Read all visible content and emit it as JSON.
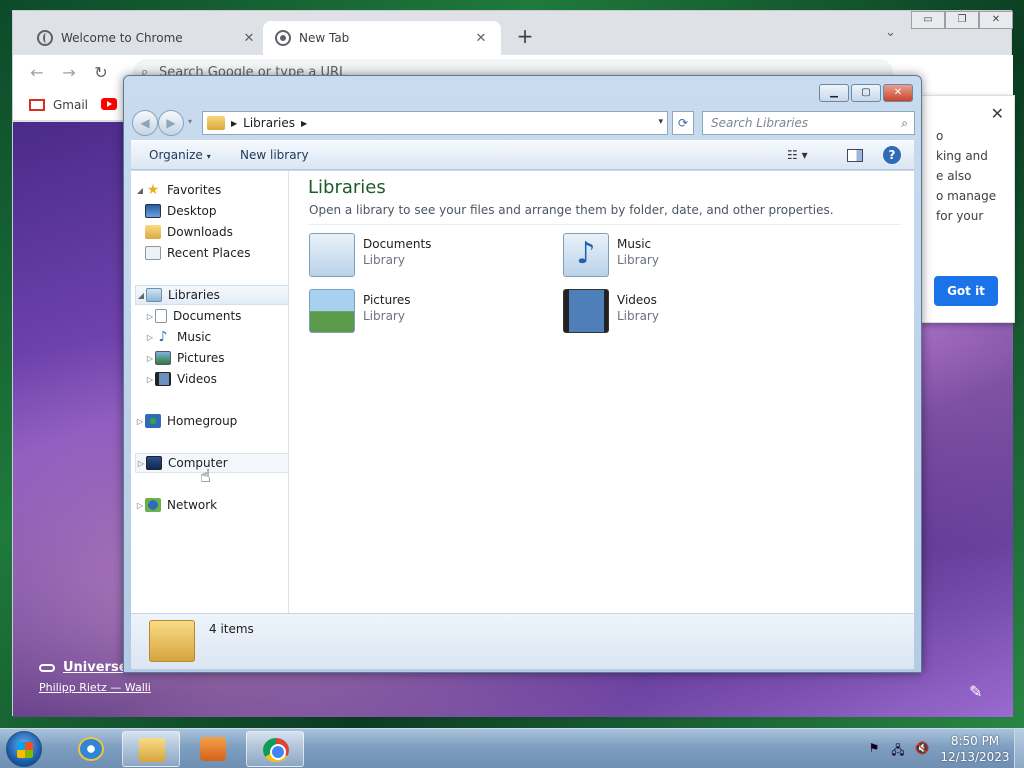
{
  "chrome": {
    "tabs": [
      {
        "label": "Welcome to Chrome",
        "close": "✕"
      },
      {
        "label": "New Tab",
        "close": "✕"
      }
    ],
    "new_tab": "+",
    "tab_search": "⌄",
    "window_controls": {
      "minimize": "▭",
      "restore": "❐",
      "close": "✕"
    },
    "toolbar": {
      "back": "←",
      "forward": "→",
      "reload": "↻",
      "omnibox_placeholder": "Search Google or type a URL"
    },
    "bookmarks": [
      {
        "label": "Gmail"
      }
    ],
    "background_credit": {
      "title": "Universe",
      "author": "Philipp Rietz — Walli"
    },
    "signin_popup": {
      "close": "✕",
      "lines": [
        "o",
        "king and",
        "e also",
        "o manage",
        "for your"
      ],
      "button": "Got it"
    }
  },
  "explorer": {
    "caption": {
      "minimize": "▁",
      "maximize": "▢",
      "close": "✕"
    },
    "nav": {
      "back": "◀",
      "forward": "▶",
      "recent": "▾"
    },
    "address": {
      "breadcrumb": "Libraries",
      "arrow": "▶",
      "dropdown": "▾"
    },
    "refresh": "⟳",
    "search": {
      "placeholder": "Search Libraries",
      "icon": "⌕"
    },
    "commandbar": {
      "organize": "Organize",
      "organize_dd": "▾",
      "new_library": "New library",
      "view": "☷ ▾",
      "help": "?"
    },
    "tree": {
      "favorites": {
        "label": "Favorites",
        "expander": "◢",
        "icon": "★"
      },
      "favorites_items": [
        "Desktop",
        "Downloads",
        "Recent Places"
      ],
      "libraries": {
        "label": "Libraries",
        "expander": "◢"
      },
      "libraries_items": [
        {
          "label": "Documents",
          "expander": "▷"
        },
        {
          "label": "Music",
          "expander": "▷",
          "icon": "♪"
        },
        {
          "label": "Pictures",
          "expander": "▷"
        },
        {
          "label": "Videos",
          "expander": "▷"
        }
      ],
      "homegroup": {
        "label": "Homegroup",
        "expander": "▷"
      },
      "computer": {
        "label": "Computer",
        "expander": "▷"
      },
      "network": {
        "label": "Network",
        "expander": "▷"
      }
    },
    "content": {
      "title": "Libraries",
      "description": "Open a library to see your files and arrange them by folder, date, and other properties.",
      "items": [
        {
          "name": "Documents",
          "type": "Library"
        },
        {
          "name": "Music",
          "type": "Library",
          "glyph": "♪"
        },
        {
          "name": "Pictures",
          "type": "Library"
        },
        {
          "name": "Videos",
          "type": "Library"
        }
      ]
    },
    "details": {
      "count": "4 items"
    }
  },
  "taskbar": {
    "tray": {
      "flag": "⚑",
      "network": "🖧",
      "volume": "🔇"
    },
    "clock": {
      "time": "8:50 PM",
      "date": "12/13/2023"
    }
  }
}
